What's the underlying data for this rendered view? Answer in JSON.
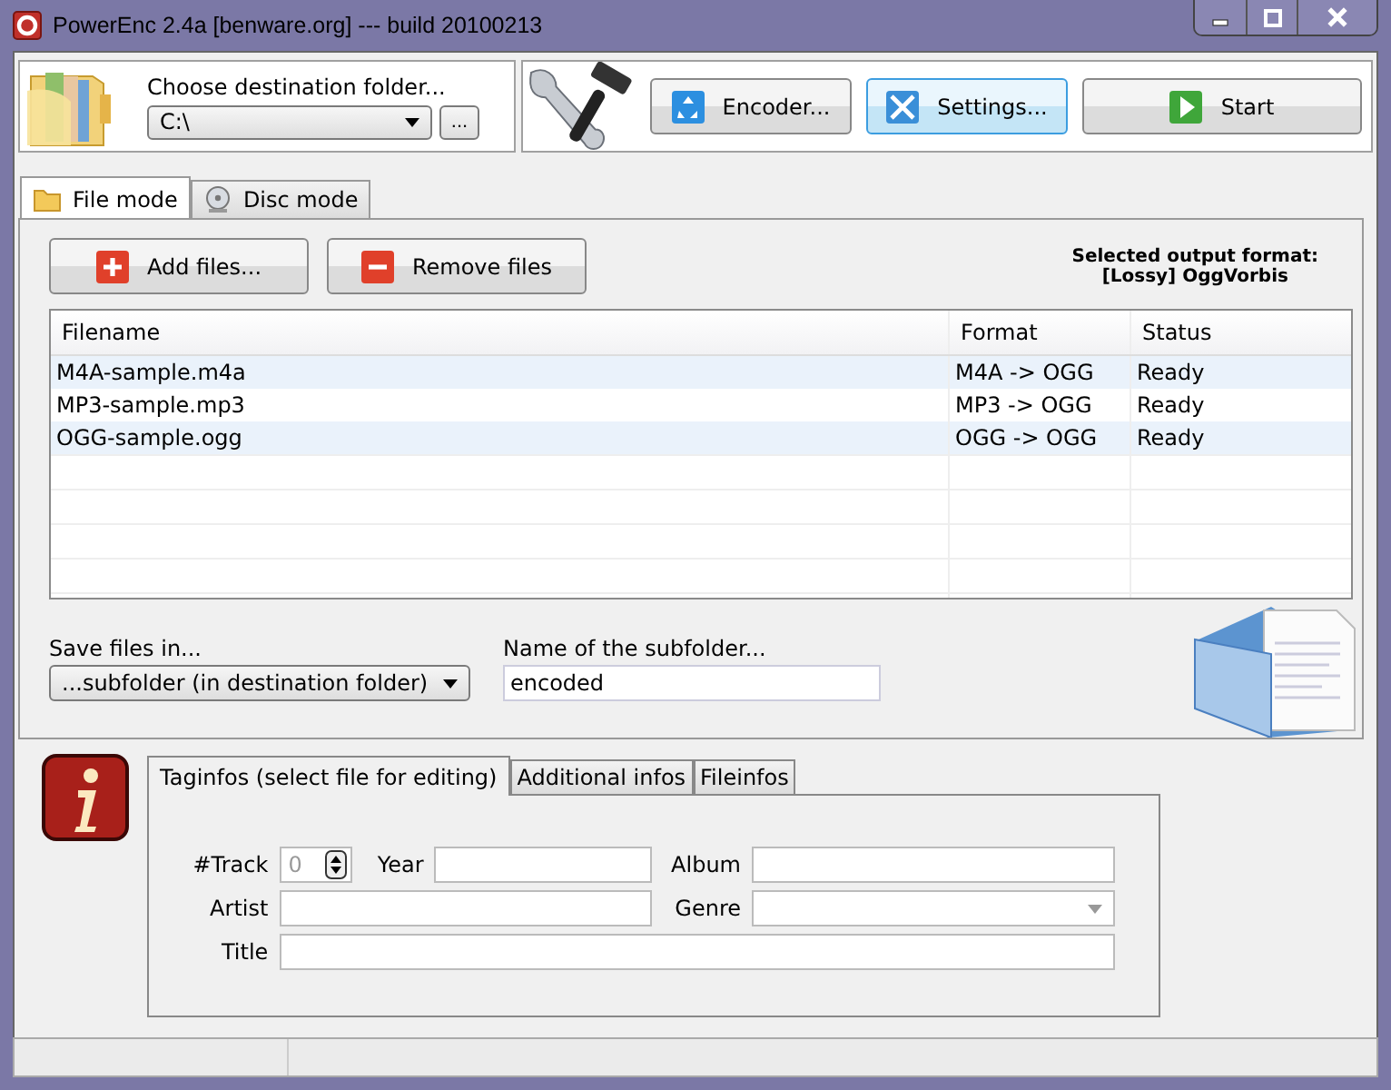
{
  "window": {
    "title": "PowerEnc 2.4a [benware.org] --- build 20100213"
  },
  "destination": {
    "label": "Choose destination folder...",
    "value": "C:\\",
    "browse": "..."
  },
  "toolbar": [
    {
      "label": "Encoder...",
      "kind": "encoder",
      "focused": false
    },
    {
      "label": "Settings...",
      "kind": "settings",
      "focused": true
    },
    {
      "label": "Start",
      "kind": "start",
      "focused": false
    }
  ],
  "tabs": [
    {
      "label": "File mode",
      "kind": "folder",
      "selected": true
    },
    {
      "label": "Disc mode",
      "kind": "disc",
      "selected": false
    }
  ],
  "file_buttons": [
    {
      "label": "Add files...",
      "kind": "add"
    },
    {
      "label": "Remove files",
      "kind": "remove"
    }
  ],
  "output_format": {
    "label": "Selected output format:",
    "value": "[Lossy] OggVorbis"
  },
  "table": {
    "columns": [
      "Filename",
      "Format",
      "Status"
    ],
    "rows": [
      [
        "M4A-sample.m4a",
        "M4A -> OGG",
        "Ready"
      ],
      [
        "MP3-sample.mp3",
        "MP3 -> OGG",
        "Ready"
      ],
      [
        "OGG-sample.ogg",
        "OGG -> OGG",
        "Ready"
      ]
    ]
  },
  "save_in": {
    "label": "Save files in...",
    "value": "...subfolder (in destination folder)"
  },
  "subfolder": {
    "label": "Name of the subfolder...",
    "value": "encoded"
  },
  "tag_tabs": [
    {
      "label": "Taginfos (select file for editing)",
      "selected": true
    },
    {
      "label": "Additional infos",
      "selected": false
    },
    {
      "label": "Fileinfos",
      "selected": false
    }
  ],
  "tags": {
    "track_label": "#Track",
    "track": "0",
    "year_label": "Year",
    "album_label": "Album",
    "artist_label": "Artist",
    "genre_label": "Genre",
    "title_label": "Title"
  }
}
